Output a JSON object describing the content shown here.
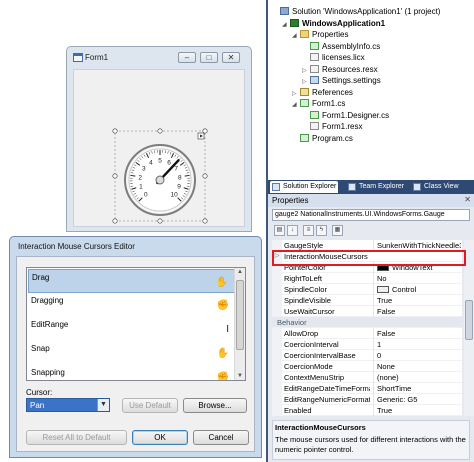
{
  "form": {
    "title": "Form1",
    "caption_buttons": [
      "–",
      "□",
      "✕"
    ]
  },
  "gauge": {
    "ticks": [
      "0",
      "1",
      "2",
      "3",
      "4",
      "5",
      "6",
      "7",
      "8",
      "9",
      "10"
    ],
    "needle_value": 6.6
  },
  "dialog": {
    "title": "Interaction Mouse Cursors Editor",
    "items": [
      {
        "label": "Drag",
        "cursor": "hand-icon",
        "glyph": "✋",
        "selected": true
      },
      {
        "label": "Dragging",
        "cursor": "grab-icon",
        "glyph": "✊",
        "selected": false
      },
      {
        "label": "EditRange",
        "cursor": "ibeam-icon",
        "glyph": "I",
        "selected": false
      },
      {
        "label": "Snap",
        "cursor": "hand-icon",
        "glyph": "✋",
        "selected": false
      },
      {
        "label": "Snapping",
        "cursor": "grab-icon",
        "glyph": "✊",
        "selected": false
      }
    ],
    "cursor_label": "Cursor:",
    "cursor_value": "Pan",
    "use_default": "Use Default",
    "browse": "Browse...",
    "reset_all": "Reset All to Default",
    "ok": "OK",
    "cancel": "Cancel"
  },
  "solution": {
    "nodes": [
      {
        "label": "Solution 'WindowsApplication1' (1 project)",
        "indent": 0,
        "icon": "sol",
        "exp": ""
      },
      {
        "label": "WindowsApplication1",
        "indent": 1,
        "icon": "proj",
        "exp": "◢",
        "bold": true
      },
      {
        "label": "Properties",
        "indent": 2,
        "icon": "folder",
        "exp": "◢"
      },
      {
        "label": "AssemblyInfo.cs",
        "indent": 3,
        "icon": "cs",
        "exp": ""
      },
      {
        "label": "licenses.licx",
        "indent": 3,
        "icon": "res",
        "exp": ""
      },
      {
        "label": "Resources.resx",
        "indent": 3,
        "icon": "res",
        "exp": "▷"
      },
      {
        "label": "Settings.settings",
        "indent": 3,
        "icon": "set",
        "exp": "▷"
      },
      {
        "label": "References",
        "indent": 2,
        "icon": "ref",
        "exp": "▷"
      },
      {
        "label": "Form1.cs",
        "indent": 2,
        "icon": "cs",
        "exp": "◢"
      },
      {
        "label": "Form1.Designer.cs",
        "indent": 3,
        "icon": "cs",
        "exp": ""
      },
      {
        "label": "Form1.resx",
        "indent": 3,
        "icon": "res",
        "exp": ""
      },
      {
        "label": "Program.cs",
        "indent": 2,
        "icon": "cs",
        "exp": ""
      }
    ]
  },
  "tabs": [
    {
      "label": "Solution Explorer",
      "active": true
    },
    {
      "label": "Team Explorer",
      "active": false
    },
    {
      "label": "Class View",
      "active": false
    }
  ],
  "properties": {
    "title": "Properties",
    "close": "✕",
    "object": "gauge2  NationalInstruments.UI.WindowsForms.Gauge",
    "rows": [
      {
        "name": "GaugeStyle",
        "value": "SunkenWithThickNeedle3D",
        "kind": "prop"
      },
      {
        "name": "InteractionMouseCursors",
        "value": "",
        "kind": "prop",
        "expand": "▷"
      },
      {
        "name": "PointerColor",
        "value": "WindowText",
        "kind": "color",
        "color": "#000000"
      },
      {
        "name": "RightToLeft",
        "value": "No",
        "kind": "prop"
      },
      {
        "name": "SpindleColor",
        "value": "Control",
        "kind": "color",
        "color": "#f0f0f0"
      },
      {
        "name": "SpindleVisible",
        "value": "True",
        "kind": "prop"
      },
      {
        "name": "UseWaitCursor",
        "value": "False",
        "kind": "prop"
      },
      {
        "name": "Behavior",
        "value": "",
        "kind": "cat"
      },
      {
        "name": "AllowDrop",
        "value": "False",
        "kind": "prop"
      },
      {
        "name": "CoercionInterval",
        "value": "1",
        "kind": "prop"
      },
      {
        "name": "CoercionIntervalBase",
        "value": "0",
        "kind": "prop"
      },
      {
        "name": "CoercionMode",
        "value": "None",
        "kind": "prop"
      },
      {
        "name": "ContextMenuStrip",
        "value": "(none)",
        "kind": "prop"
      },
      {
        "name": "EditRangeDateTimeForma",
        "value": "ShortTime",
        "kind": "prop"
      },
      {
        "name": "EditRangeNumericFormat",
        "value": "Generic: G5",
        "kind": "prop"
      },
      {
        "name": "Enabled",
        "value": "True",
        "kind": "prop"
      }
    ],
    "desc_title": "InteractionMouseCursors",
    "desc_text": "The mouse cursors used for different interactions with the numeric pointer control."
  },
  "colors": {
    "highlight": "#e01b24",
    "selection": "#bcd3ea",
    "combo": "#3b74c6"
  }
}
